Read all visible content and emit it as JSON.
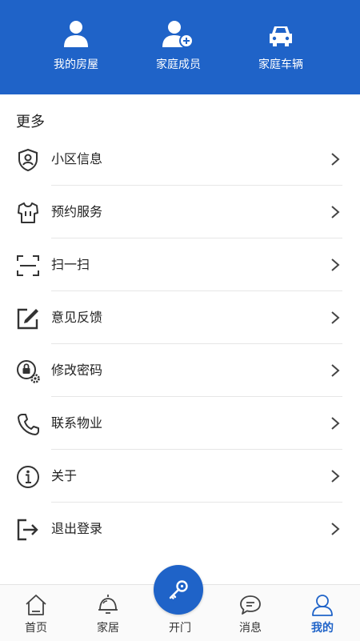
{
  "header": {
    "bg_color": "#1f63c8",
    "items": [
      {
        "label": "我的房屋",
        "icon": "user-icon"
      },
      {
        "label": "家庭成员",
        "icon": "user-add-icon"
      },
      {
        "label": "家庭车辆",
        "icon": "car-icon"
      }
    ]
  },
  "more": {
    "title": "更多",
    "items": [
      {
        "label": "小区信息",
        "icon": "shield-user-icon"
      },
      {
        "label": "预约服务",
        "icon": "shirt-icon"
      },
      {
        "label": "扫一扫",
        "icon": "scan-icon"
      },
      {
        "label": "意见反馈",
        "icon": "edit-icon"
      },
      {
        "label": "修改密码",
        "icon": "lock-settings-icon"
      },
      {
        "label": "联系物业",
        "icon": "phone-icon"
      },
      {
        "label": "关于",
        "icon": "info-icon"
      },
      {
        "label": "退出登录",
        "icon": "logout-icon"
      }
    ]
  },
  "nav": {
    "accent": "#1f63c8",
    "tabs": [
      {
        "label": "首页",
        "icon": "home-icon"
      },
      {
        "label": "家居",
        "icon": "bell-icon"
      },
      {
        "label": "开门",
        "icon": "key-icon"
      },
      {
        "label": "消息",
        "icon": "message-icon"
      },
      {
        "label": "我的",
        "icon": "user-outline-icon",
        "active": true
      }
    ]
  }
}
